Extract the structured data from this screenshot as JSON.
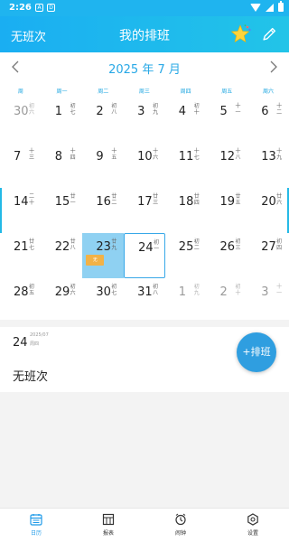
{
  "status": {
    "time": "2:26",
    "notif1": "A",
    "notif2": "D"
  },
  "header": {
    "left_label": "无班次",
    "title": "我的排班"
  },
  "calendar": {
    "month_label": "2025 年 7 月",
    "weekdays": [
      "周",
      "周一",
      "周二",
      "周三",
      "周四",
      "周五",
      "周六",
      "周日"
    ],
    "rows": [
      [
        {
          "d": "30",
          "l": "初六",
          "g": true
        },
        {
          "d": "1",
          "l": "初七"
        },
        {
          "d": "2",
          "l": "初八"
        },
        {
          "d": "3",
          "l": "初九"
        },
        {
          "d": "4",
          "l": "初十"
        },
        {
          "d": "5",
          "l": "十一"
        },
        {
          "d": "6",
          "l": "十二"
        }
      ],
      [
        {
          "d": "7",
          "l": "十三"
        },
        {
          "d": "8",
          "l": "十四"
        },
        {
          "d": "9",
          "l": "十五"
        },
        {
          "d": "10",
          "l": "十六"
        },
        {
          "d": "11",
          "l": "十七"
        },
        {
          "d": "12",
          "l": "十八"
        },
        {
          "d": "13",
          "l": "十九"
        }
      ],
      [
        {
          "d": "14",
          "l": "二十"
        },
        {
          "d": "15",
          "l": "廿一"
        },
        {
          "d": "16",
          "l": "廿二"
        },
        {
          "d": "17",
          "l": "廿三"
        },
        {
          "d": "18",
          "l": "廿四"
        },
        {
          "d": "19",
          "l": "廿五"
        },
        {
          "d": "20",
          "l": "廿六"
        }
      ],
      [
        {
          "d": "21",
          "l": "廿七"
        },
        {
          "d": "22",
          "l": "廿八"
        },
        {
          "d": "23",
          "l": "廿九",
          "sel": true,
          "tag": "无"
        },
        {
          "d": "24",
          "l": "初一",
          "today": true
        },
        {
          "d": "25",
          "l": "初二"
        },
        {
          "d": "26",
          "l": "初三"
        },
        {
          "d": "27",
          "l": "初四"
        }
      ],
      [
        {
          "d": "28",
          "l": "初五"
        },
        {
          "d": "29",
          "l": "初六"
        },
        {
          "d": "30",
          "l": "初七"
        },
        {
          "d": "31",
          "l": "初八"
        },
        {
          "d": "1",
          "l": "初九",
          "g": true
        },
        {
          "d": "2",
          "l": "初十",
          "g": true
        },
        {
          "d": "3",
          "l": "十一",
          "g": true
        }
      ]
    ]
  },
  "detail": {
    "day": "24",
    "date": "2025/07",
    "week": "周四",
    "shift": "无班次",
    "add_label": "+排班"
  },
  "bottom_nav": [
    {
      "label": "日历",
      "icon": "calendar-icon",
      "active": true
    },
    {
      "label": "报表",
      "icon": "report-icon"
    },
    {
      "label": "闹钟",
      "icon": "alarm-icon"
    },
    {
      "label": "设置",
      "icon": "settings-icon"
    }
  ],
  "colors": {
    "accent": "#1e9ae8",
    "header": "#1aaef2",
    "selected": "#8fd1f2",
    "tag": "#f2b247"
  }
}
